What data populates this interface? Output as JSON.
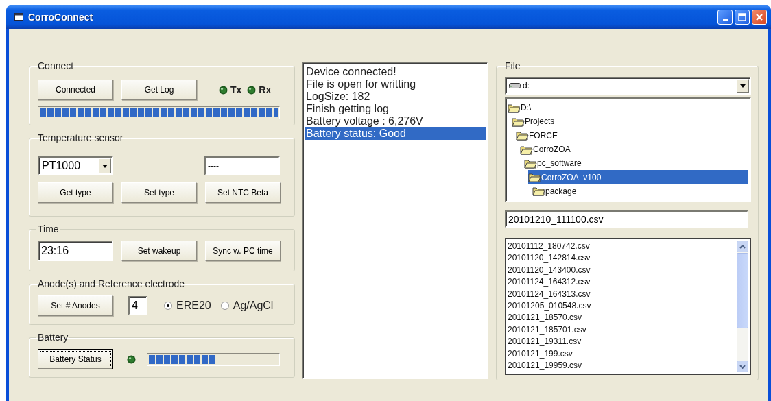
{
  "window": {
    "title": "CorroConnect"
  },
  "connect": {
    "label": "Connect",
    "buttons": [
      "Connected",
      "Get Log"
    ],
    "indicators": [
      "Tx",
      "Rx"
    ],
    "progress": {
      "level": 1
    }
  },
  "temperature": {
    "label": "Temperature sensor",
    "sensor_type": "PT1000",
    "value": "----",
    "buttons": [
      "Get type",
      "Set type",
      "Set NTC Beta"
    ]
  },
  "time": {
    "label": "Time",
    "value": "23:16",
    "buttons": [
      "Set wakeup",
      "Sync w. PC time"
    ]
  },
  "anodes": {
    "label": "Anode(s) and Reference electrode",
    "button": "Set # Anodes",
    "count": "4",
    "electrodes": [
      {
        "label": "ERE20",
        "selected": true
      },
      {
        "label": "Ag/AgCl",
        "selected": false
      }
    ]
  },
  "battery": {
    "label": "Battery",
    "button": {
      "label": "Battery Status",
      "focused": true
    },
    "progress": {
      "level": 0.53
    }
  },
  "log": {
    "items": [
      {
        "text": "Device connected!",
        "selected": false
      },
      {
        "text": "File is open for writting",
        "selected": false
      },
      {
        "text": "LogSize: 182",
        "selected": false
      },
      {
        "text": "Finish getting log",
        "selected": false
      },
      {
        "text": "Battery voltage : 6,276V",
        "selected": false
      },
      {
        "text": "Battery status: Good",
        "selected": true
      }
    ]
  },
  "file": {
    "label": "File",
    "drive": "d:",
    "folders": [
      {
        "name": "D:\\",
        "selected": false,
        "children": [
          {
            "name": "Projects",
            "selected": false,
            "children": [
              {
                "name": "FORCE",
                "selected": false,
                "children": [
                  {
                    "name": "CorroZOA",
                    "selected": false,
                    "children": [
                      {
                        "name": "pc_software",
                        "selected": false,
                        "children": [
                          {
                            "name": "CorroZOA_v100",
                            "selected": true,
                            "children": [
                              {
                                "name": "package",
                                "selected": false
                              }
                            ]
                          }
                        ]
                      }
                    ]
                  }
                ]
              }
            ]
          }
        ]
      }
    ],
    "filename": "20101210_111100.csv",
    "files": [
      "20101112_180742.csv",
      "20101120_142814.csv",
      "20101120_143400.csv",
      "20101124_164312.csv",
      "20101124_164313.csv",
      "20101205_010548.csv",
      "2010121_18570.csv",
      "2010121_185701.csv",
      "2010121_19311.csv",
      "2010121_199.csv",
      "2010121_19959.csv"
    ]
  }
}
